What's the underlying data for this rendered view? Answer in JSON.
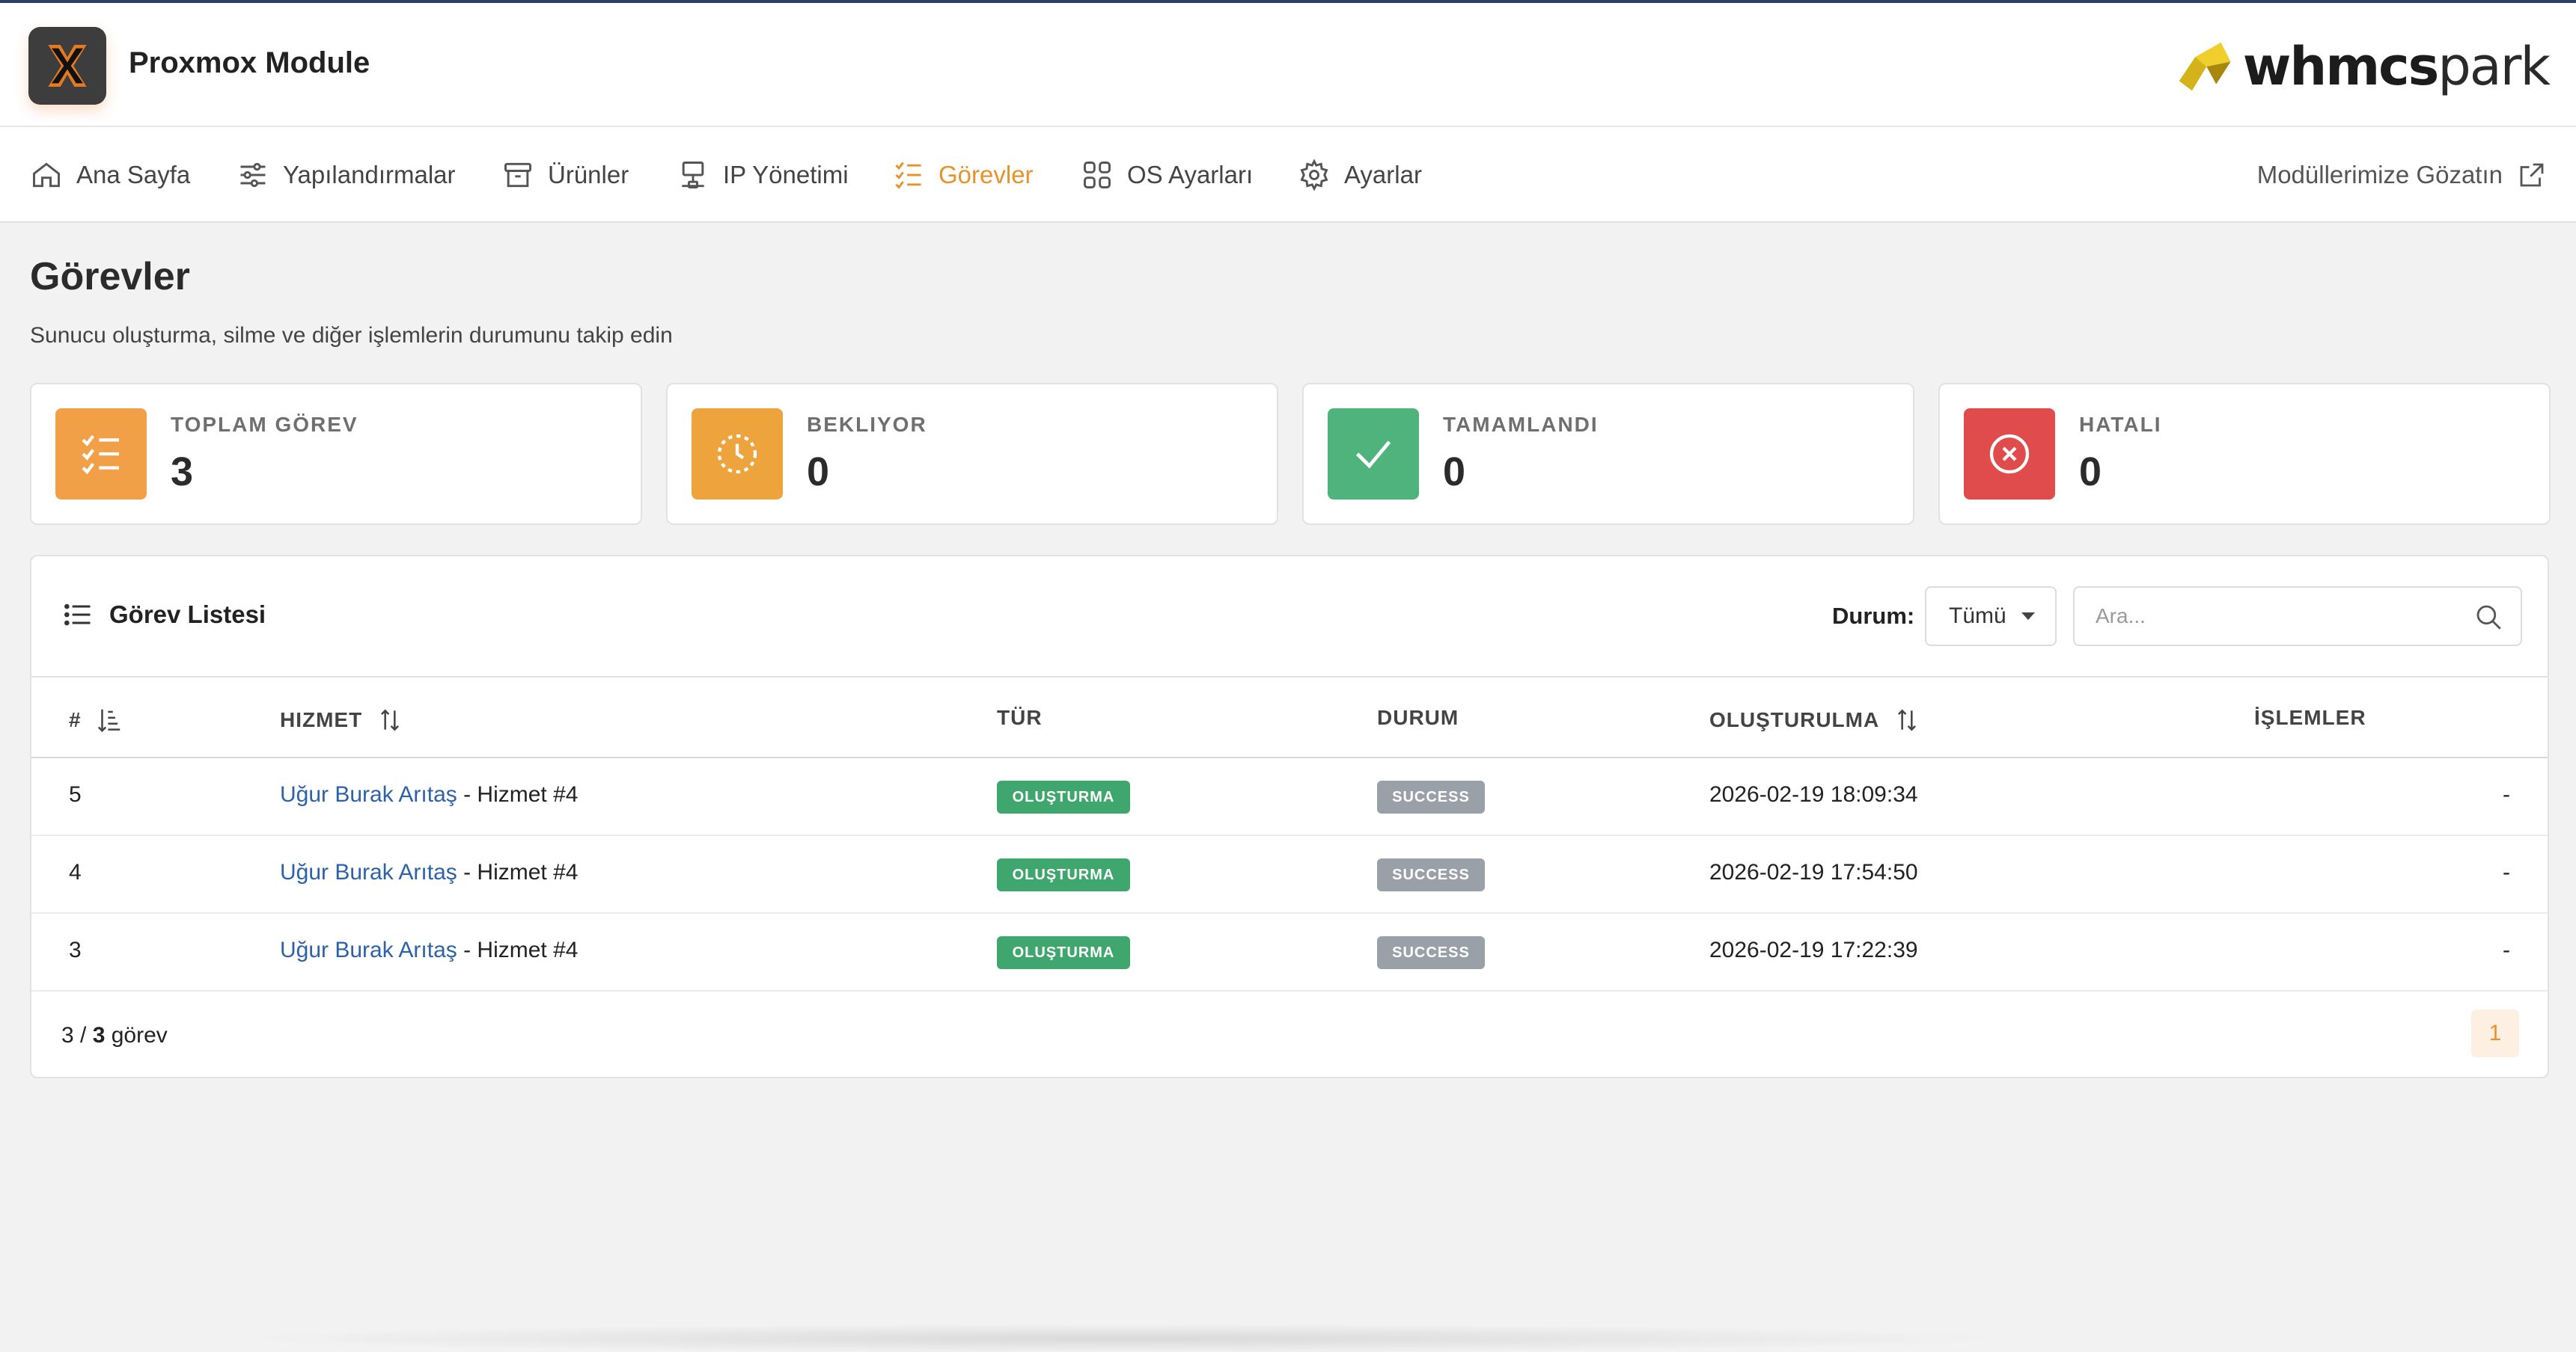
{
  "app": {
    "title": "Proxmox Module",
    "brand_bold": "whmcs",
    "brand_light": "park"
  },
  "nav": {
    "items": [
      {
        "label": "Ana Sayfa",
        "icon": "home-icon"
      },
      {
        "label": "Yapılandırmalar",
        "icon": "sliders-icon"
      },
      {
        "label": "Ürünler",
        "icon": "archive-box-icon"
      },
      {
        "label": "IP Yönetimi",
        "icon": "network-icon"
      },
      {
        "label": "Görevler",
        "icon": "task-list-icon",
        "active": true
      },
      {
        "label": "OS Ayarları",
        "icon": "grid-icon"
      },
      {
        "label": "Ayarlar",
        "icon": "gear-icon"
      }
    ],
    "external_label": "Modüllerimize Gözatın"
  },
  "page": {
    "title": "Görevler",
    "subtitle": "Sunucu oluşturma, silme ve diğer işlemlerin durumunu takip edin"
  },
  "stats": [
    {
      "label": "TOPLAM GÖREV",
      "value": "3",
      "color": "#f2a047",
      "icon": "task-list-icon"
    },
    {
      "label": "BEKLIYOR",
      "value": "0",
      "color": "#eda43c",
      "icon": "clock-icon"
    },
    {
      "label": "TAMAMLANDI",
      "value": "0",
      "color": "#4fb37c",
      "icon": "check-icon"
    },
    {
      "label": "HATALI",
      "value": "0",
      "color": "#e04b4b",
      "icon": "x-circle-icon"
    }
  ],
  "table": {
    "title": "Görev Listesi",
    "filter_label": "Durum:",
    "filter_value": "Tümü",
    "search_placeholder": "Ara...",
    "columns": [
      "#",
      "HIZMET",
      "TÜR",
      "DURUM",
      "OLUŞTURULMA",
      "İŞLEMLER"
    ],
    "rows": [
      {
        "id": "5",
        "customer": "Uğur Burak Arıtaş",
        "service": " - Hizmet #4",
        "type": "OLUŞTURMA",
        "status": "SUCCESS",
        "created": "2026-02-19 18:09:34",
        "actions": "-"
      },
      {
        "id": "4",
        "customer": "Uğur Burak Arıtaş",
        "service": " - Hizmet #4",
        "type": "OLUŞTURMA",
        "status": "SUCCESS",
        "created": "2026-02-19 17:54:50",
        "actions": "-"
      },
      {
        "id": "3",
        "customer": "Uğur Burak Arıtaş",
        "service": " - Hizmet #4",
        "type": "OLUŞTURMA",
        "status": "SUCCESS",
        "created": "2026-02-19 17:22:39",
        "actions": "-"
      }
    ],
    "footer_prefix": "3 / ",
    "footer_count": "3",
    "footer_suffix": " görev",
    "current_page": "1"
  }
}
